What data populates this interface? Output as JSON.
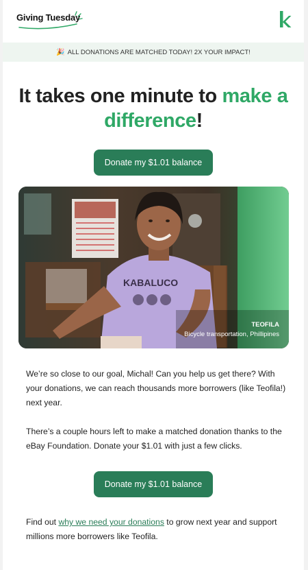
{
  "header": {
    "brand_name": "Giving Tuesday",
    "brand_accent": "#2fa866",
    "right_logo_icon": "kiva-k-logo"
  },
  "banner": {
    "emoji_icon": "party-popper-icon",
    "emoji": "🎉",
    "text": "ALL DONATIONS ARE MATCHED TODAY! 2X YOUR IMPACT!"
  },
  "headline": {
    "part1": "It takes one minute to ",
    "highlight": "make a difference",
    "part2": "!"
  },
  "cta": {
    "label": "Donate my $1.01 balance",
    "color": "#2a7d58"
  },
  "photo": {
    "name": "TEOFILA",
    "subtitle": "Bicycle transportation, Phillipines"
  },
  "body": {
    "paragraph1": "We’re so close to our goal, Michal! Can you help us get there? With your donations, we can reach thousands more borrowers (like Teofila!) next year.",
    "paragraph2": "There’s a couple hours left to make a matched donation thanks to the eBay Foundation. Donate your $1.01 with just a few clicks.",
    "footer_before": "Find out ",
    "footer_link": "why we need your donations",
    "footer_after": " to grow next year and support millions more borrowers like Teofila."
  }
}
